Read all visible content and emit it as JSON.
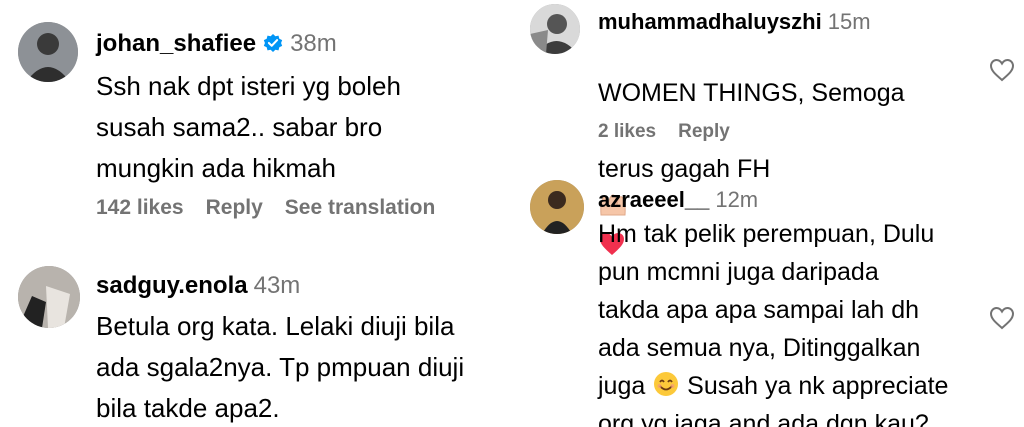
{
  "left": {
    "comments": [
      {
        "username": "johan_shafiee",
        "time": "38m",
        "text": "Ssh nak dpt isteri yg boleh\nsusah sama2.. sabar bro\nmungkin ada hikmah",
        "likes": "142 likes",
        "reply": "Reply",
        "translate": "See translation"
      },
      {
        "username": "sadguy.enola",
        "time": "43m",
        "text": "Betula org kata. Lelaki diuji bila\nada sgala2nya. Tp pmpuan diuji\nbila takde apa2."
      }
    ]
  },
  "right": {
    "comments": [
      {
        "username": "muhammadhaluyszhi",
        "time": "15m",
        "text_line1": "WOMEN THINGS, Semoga",
        "text_line2": "terus gagah FH",
        "likes": "2 likes",
        "reply": "Reply"
      },
      {
        "username": "azraeeel__",
        "time": "12m",
        "text_part1": "Hm tak pelik perempuan, Dulu\npun mcmni juga daripada\ntakda apa apa sampai lah dh\nada semua nya, Ditinggalkan\njuga",
        "text_part2": " Susah ya nk appreciate\norg yg jaga and ada dgn kau?"
      }
    ]
  },
  "colors": {
    "verified": "#0095f6",
    "heart": "#ff3040",
    "muted": "#737373"
  },
  "icons": [
    "verified-badge-icon",
    "heart-outline-icon",
    "palms-up-emoji",
    "red-heart-emoji",
    "smiling-face-emoji"
  ]
}
